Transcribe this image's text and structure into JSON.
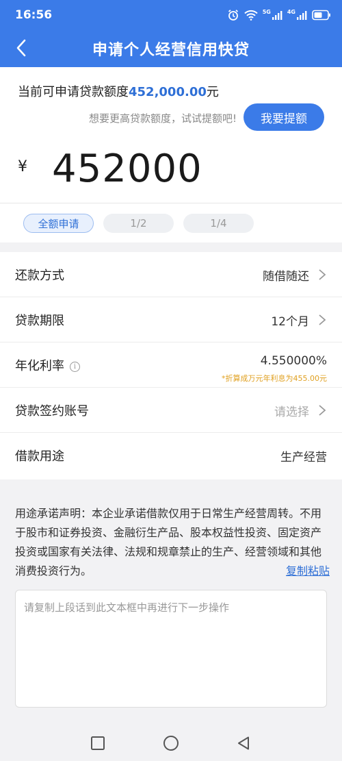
{
  "status": {
    "time": "16:56",
    "signal_1": "5G",
    "signal_2": "4G"
  },
  "nav": {
    "title": "申请个人经营信用快贷"
  },
  "amount_section": {
    "quota_prefix": "当前可申请贷款额度",
    "quota_value": "452,000.00",
    "quota_suffix": "元",
    "hint": "想要更高贷款额度，试试提额吧!",
    "raise_button": "我要提额",
    "currency": "¥",
    "amount": "452000",
    "chips": [
      "全额申请",
      "1/2",
      "1/4"
    ]
  },
  "form": {
    "repayment_label": "还款方式",
    "repayment_value": "随借随还",
    "term_label": "贷款期限",
    "term_value": "12个月",
    "rate_label": "年化利率",
    "rate_info": "i",
    "rate_value": "4.550000%",
    "rate_note": "*折算成万元年利息为455.00元",
    "account_label": "贷款签约账号",
    "account_placeholder": "请选择",
    "purpose_label": "借款用途",
    "purpose_value": "生产经营"
  },
  "statement": {
    "text": "用途承诺声明：本企业承诺借款仅用于日常生产经营周转。不用于股市和证券投资、金融衍生产品、股本权益性投资、固定资产投资或国家有关法律、法规和规章禁止的生产、经营领域和其他消费投资行为。",
    "copy_link": "复制粘贴"
  },
  "textbox": {
    "placeholder": "请复制上段话到此文本框中再进行下一步操作"
  },
  "colors": {
    "primary": "#3b7be8",
    "link": "#2e6fd6",
    "note": "#e0a020"
  }
}
